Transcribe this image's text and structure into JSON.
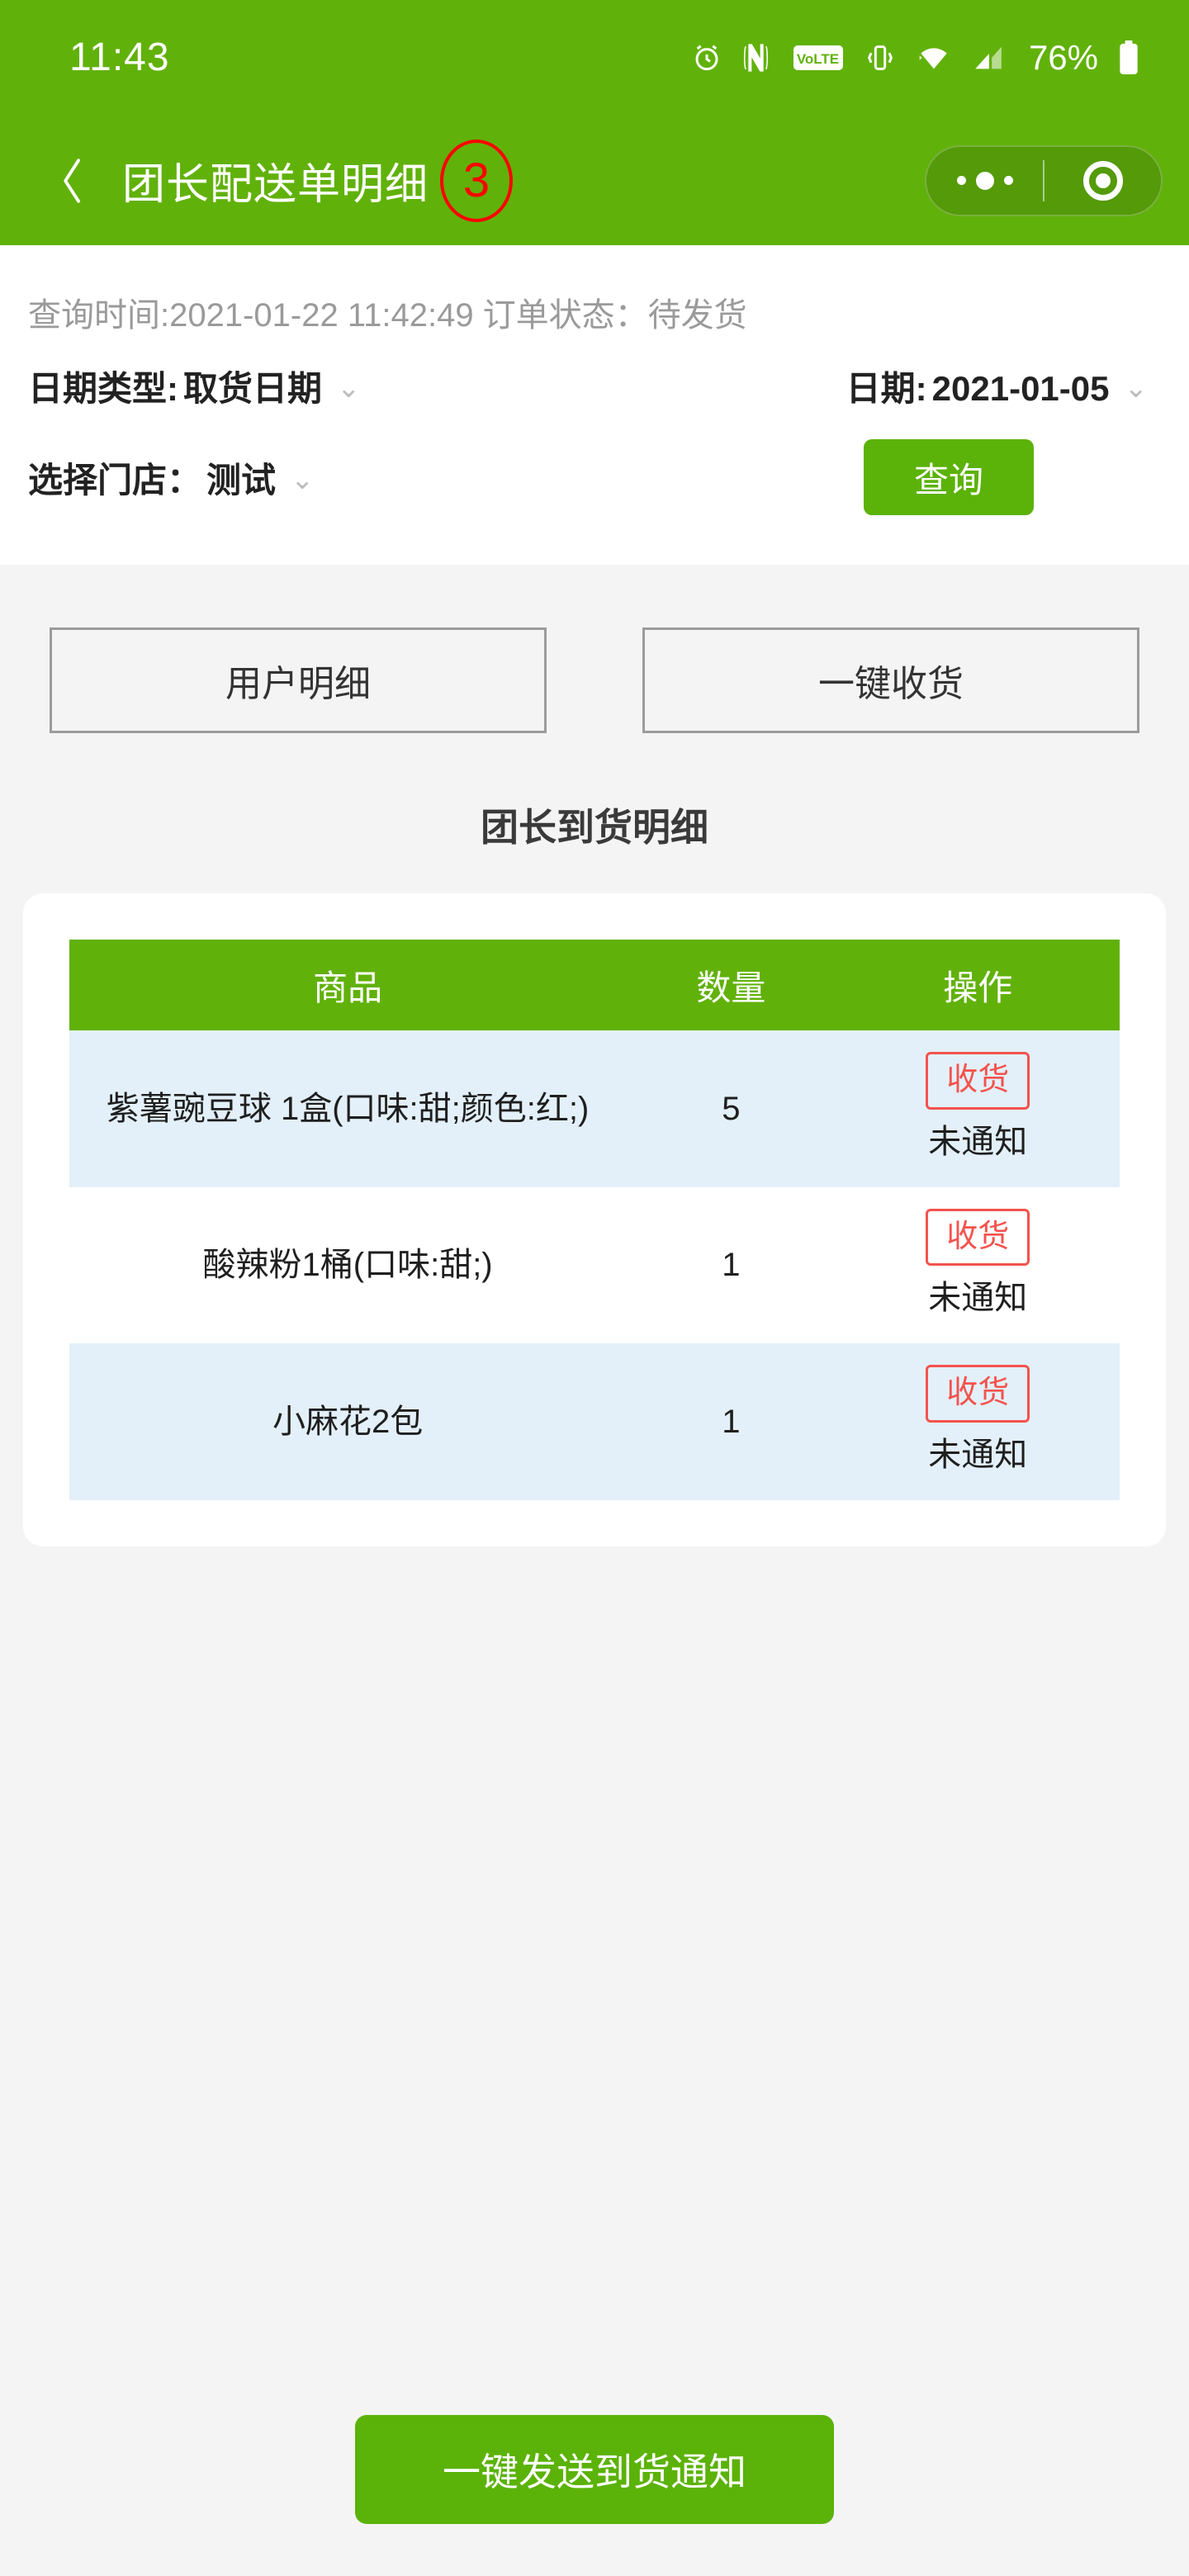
{
  "theme": {
    "header_green": "#61b10b",
    "button_green": "#5bb208",
    "row_alt_blue": "#e3f0f9",
    "accent_red": "#f4524d",
    "badge_red": "#ff0000",
    "page_gray": "#f4f4f4"
  },
  "statusbar": {
    "time": "11:43",
    "battery_percent": "76%",
    "icons": [
      "alarm-icon",
      "nfc-icon",
      "volte-icon",
      "vibrate-icon",
      "wifi-icon",
      "signal-icon",
      "battery-icon"
    ]
  },
  "navbar": {
    "back_icon": "chevron-left-icon",
    "title": "团长配送单明细",
    "annotation_badge": "3",
    "capsule": {
      "more_icon": "more-dots-icon",
      "target_icon": "target-circle-icon"
    }
  },
  "query_info": {
    "text": "查询时间:2021-01-22 11:42:49 订单状态：待发货"
  },
  "filters": {
    "date_type": {
      "label": "日期类型:",
      "value": "取货日期",
      "chevron": "⌄"
    },
    "date": {
      "label": "日期:",
      "value": "2021-01-05",
      "chevron": "⌄"
    },
    "store": {
      "label": "选择门店：",
      "value": "测试",
      "chevron": "⌄"
    },
    "query_button": "查询"
  },
  "actions": {
    "user_detail": "用户明细",
    "one_key_receive": "一键收货"
  },
  "section": {
    "title": "团长到货明细"
  },
  "table": {
    "headers": {
      "product": "商品",
      "quantity": "数量",
      "operation": "操作"
    },
    "rows": [
      {
        "product": "紫薯豌豆球 1盒(口味:甜;颜色:红;)",
        "quantity": "5",
        "action_label": "收货",
        "status": "未通知"
      },
      {
        "product": "酸辣粉1桶(口味:甜;)",
        "quantity": "1",
        "action_label": "收货",
        "status": "未通知"
      },
      {
        "product": "小麻花2包",
        "quantity": "1",
        "action_label": "收货",
        "status": "未通知"
      }
    ]
  },
  "bottom": {
    "send_notice": "一键发送到货通知"
  }
}
